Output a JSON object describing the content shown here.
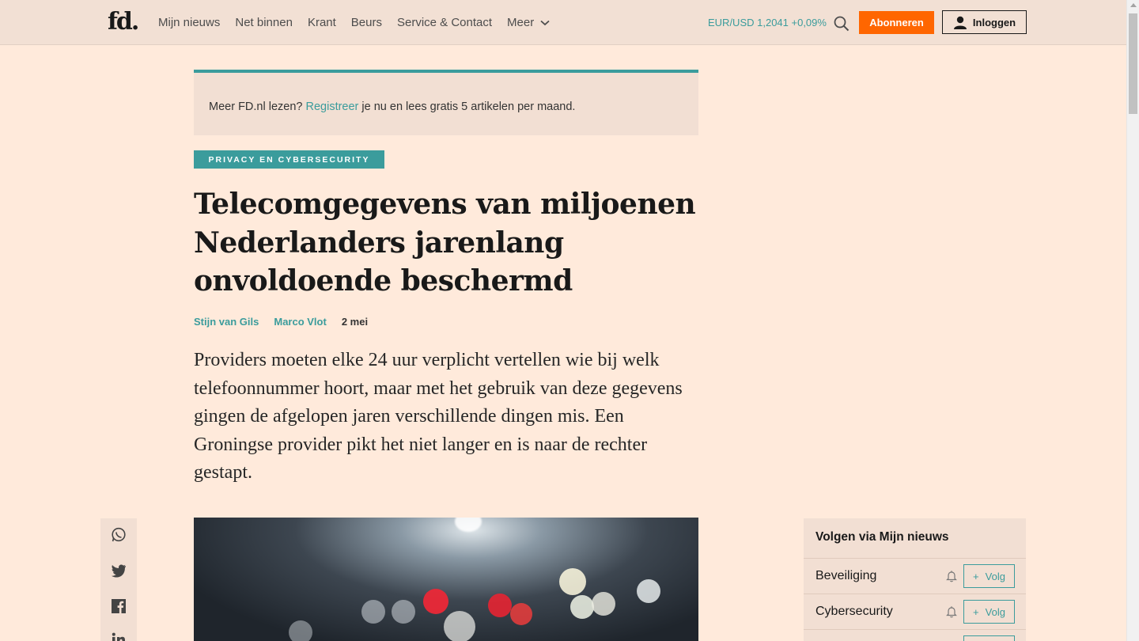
{
  "header": {
    "logo_text": "fd",
    "logo_dot": ".",
    "nav": [
      {
        "label": "Mijn nieuws"
      },
      {
        "label": "Net binnen"
      },
      {
        "label": "Krant"
      },
      {
        "label": "Beurs"
      },
      {
        "label": "Service & Contact"
      },
      {
        "label": "Meer"
      }
    ],
    "currency_ticker": "EUR/USD 1,2041 +0,09%",
    "subscribe_label": "Abonneren",
    "login_label": "Inloggen",
    "icons": {
      "search": "search-icon",
      "user": "user-icon",
      "more": "chevron-down-icon"
    }
  },
  "banner": {
    "prefix": "Meer FD.nl lezen? ",
    "link": "Registreer",
    "suffix": " je nu en lees gratis 5 artikelen per maand."
  },
  "article": {
    "tag": "PRIVACY EN CYBERSECURITY",
    "title": "Telecomgegevens van miljoenen Nederlanders jarenlang onvoldoende beschermd",
    "authors": [
      "Stijn van Gils",
      "Marco Vlot"
    ],
    "date": "2 mei",
    "intro": "Providers moeten elke 24 uur verplicht vertellen wie bij welk telefoonnummer hoort, maar met het gebruik van deze gegevens gingen de afgelopen jaren verschillende dingen mis. Een Groningse provider pikt het niet langer en is naar de rechter gestapt."
  },
  "share": [
    "whatsapp-icon",
    "twitter-icon",
    "facebook-icon",
    "linkedin-icon"
  ],
  "follow_panel": {
    "title": "Volgen via Mijn nieuws",
    "items": [
      {
        "label": "Beveiliging",
        "button": "Volg"
      },
      {
        "label": "Cybersecurity",
        "button": "Volg"
      }
    ]
  },
  "colors": {
    "accent": "#3b9c9c",
    "subscribe": "#ff6600",
    "background": "#ffeadb"
  }
}
